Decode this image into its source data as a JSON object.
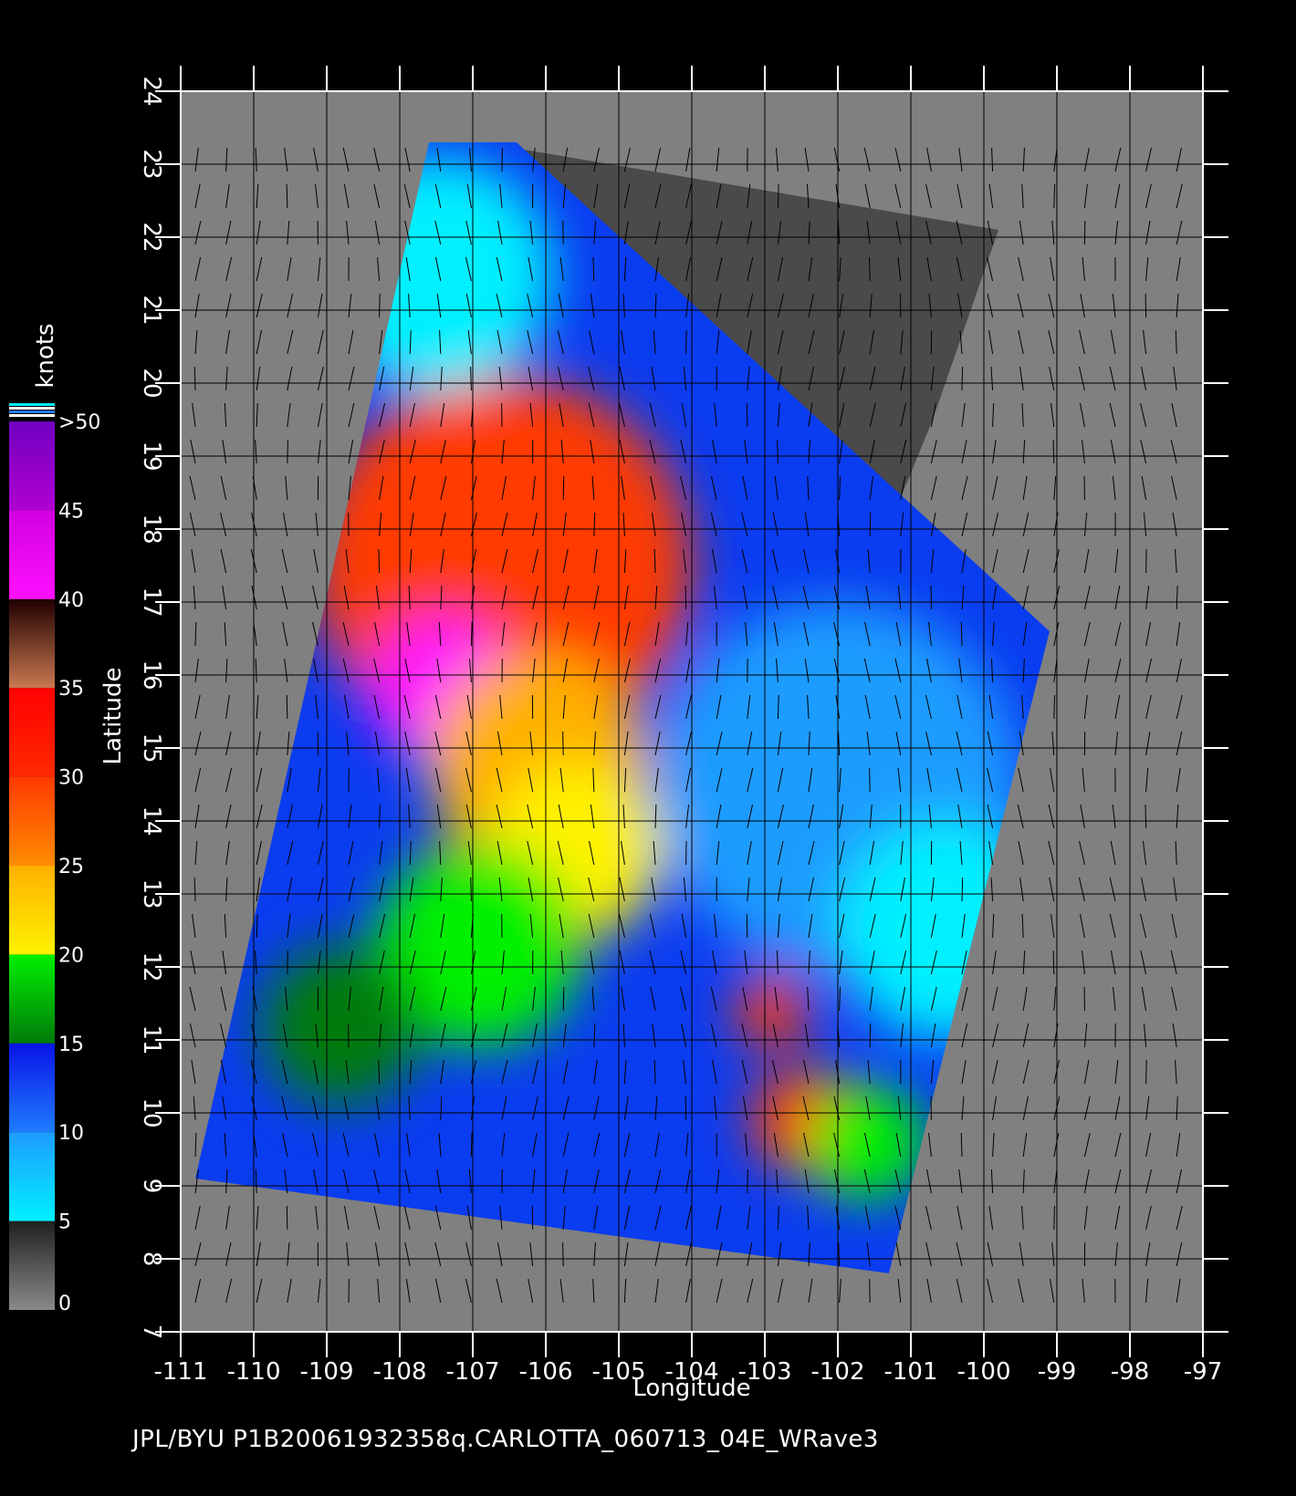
{
  "figure": {
    "caption": "JPL/BYU  P1B20061932358q.CARLOTTA_060713_04E_WRave3"
  },
  "map": {
    "x_axis_label": "Longitude",
    "y_axis_label": "Latitude",
    "lon_range": [
      -111,
      -97
    ],
    "lat_range": [
      7,
      24
    ],
    "lon_ticks": [
      "-111",
      "-110",
      "-109",
      "-108",
      "-107",
      "-106",
      "-105",
      "-104",
      "-103",
      "-102",
      "-101",
      "-100",
      "-99",
      "-98",
      "-97"
    ],
    "lat_ticks": [
      "7",
      "8",
      "9",
      "10",
      "11",
      "12",
      "13",
      "14",
      "15",
      "16",
      "17",
      "18",
      "19",
      "20",
      "21",
      "22",
      "23",
      "24"
    ],
    "grid": true,
    "land_color": "#4a4a4a",
    "no_data_color": "#808080",
    "swath_corners_lonlat": [
      [
        -107.6,
        23.3
      ],
      [
        -110.8,
        9.1
      ],
      [
        -101.3,
        7.8
      ],
      [
        -99.1,
        16.6
      ],
      [
        -106.4,
        23.3
      ]
    ],
    "wind_barbs": true
  },
  "colorbar": {
    "title": "knots",
    "labels": [
      "0",
      "5",
      "10",
      "15",
      "20",
      "25",
      "30",
      "35",
      "40",
      "45",
      ">50"
    ],
    "bands": [
      {
        "from": 0,
        "to": 5,
        "colors": [
          "#8a8a8a",
          "#1f1f1f"
        ]
      },
      {
        "from": 5,
        "to": 10,
        "colors": [
          "#00f0ff",
          "#1e9cff"
        ]
      },
      {
        "from": 10,
        "to": 15,
        "colors": [
          "#1e7cff",
          "#0a14e6"
        ]
      },
      {
        "from": 15,
        "to": 20,
        "colors": [
          "#007a0a",
          "#00f000"
        ]
      },
      {
        "from": 20,
        "to": 25,
        "colors": [
          "#fff200",
          "#ffb000"
        ]
      },
      {
        "from": 25,
        "to": 30,
        "colors": [
          "#ff8c00",
          "#ff3a00"
        ]
      },
      {
        "from": 30,
        "to": 35,
        "colors": [
          "#ff2a00",
          "#ff0000"
        ]
      },
      {
        "from": 35,
        "to": 40,
        "colors": [
          "#c87850",
          "#200000"
        ]
      },
      {
        "from": 40,
        "to": 45,
        "colors": [
          "#ff10ff",
          "#d000e0"
        ]
      },
      {
        "from": 45,
        "to": 50,
        "colors": [
          "#b000d0",
          "#7000c0"
        ]
      }
    ]
  },
  "wind_field": {
    "regions": [
      {
        "lon": -106.6,
        "lat": 17.5,
        "r": 2.6,
        "speed": 30
      },
      {
        "lon": -107.4,
        "lat": 15.8,
        "r": 1.0,
        "speed": 42
      },
      {
        "lon": -106.1,
        "lat": 14.8,
        "r": 1.5,
        "speed": 24
      },
      {
        "lon": -105.6,
        "lat": 13.6,
        "r": 1.2,
        "speed": 22
      },
      {
        "lon": -106.9,
        "lat": 12.3,
        "r": 1.4,
        "speed": 19
      },
      {
        "lon": -108.8,
        "lat": 11.2,
        "r": 1.1,
        "speed": 17
      },
      {
        "lon": -102.5,
        "lat": 9.9,
        "r": 0.7,
        "speed": 30
      },
      {
        "lon": -102.9,
        "lat": 11.4,
        "r": 0.5,
        "speed": 30
      },
      {
        "lon": -101.6,
        "lat": 9.6,
        "r": 0.8,
        "speed": 18
      },
      {
        "lon": -102.0,
        "lat": 14.5,
        "r": 2.5,
        "speed": 8
      },
      {
        "lon": -100.5,
        "lat": 12.5,
        "r": 1.5,
        "speed": 7
      },
      {
        "lon": -107.5,
        "lat": 21.5,
        "r": 1.6,
        "speed": 7
      }
    ]
  }
}
